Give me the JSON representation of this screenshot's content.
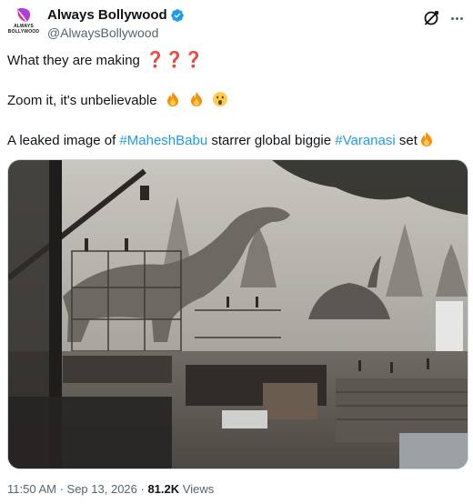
{
  "author": {
    "display_name": "Always Bollywood",
    "handle": "@AlwaysBollywood",
    "avatar_text": "ALWAYS BOLLYWOOD",
    "verified": true
  },
  "tweet": {
    "line1": "What they are making",
    "line1_marks": "❓❓❓",
    "line2": "Zoom it, it's unbelievable",
    "line3_prefix": "A leaked image of ",
    "hashtag1": "#MaheshBabu",
    "line3_mid": " starrer global biggie ",
    "hashtag2": "#Varanasi",
    "line3_suffix": " set"
  },
  "meta": {
    "time": "11:50 AM",
    "separator": " · ",
    "date": "Sep 13, 2026",
    "views_count": "81.2K",
    "views_label": " Views"
  },
  "icons": {
    "grok": "grok-icon",
    "more": "more-icon",
    "verified": "verified-badge-icon",
    "fire": "fire-emoji-icon",
    "surprised": "surprised-emoji-icon"
  },
  "colors": {
    "accent": "#1d9bf0",
    "text": "#0f1419",
    "muted": "#536471",
    "question_red": "#c0272d"
  }
}
